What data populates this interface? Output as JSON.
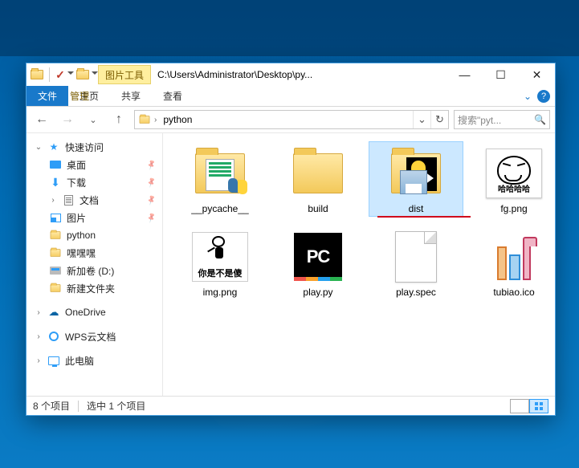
{
  "window": {
    "title_path": "C:\\Users\\Administrator\\Desktop\\py...",
    "tool_tab": "图片工具"
  },
  "ribbon": {
    "file": "文件",
    "home": "主页",
    "share": "共享",
    "view": "查看",
    "manage": "管理"
  },
  "address": {
    "segments": [
      "python"
    ],
    "search_placeholder": "搜索\"pyt..."
  },
  "sidebar": {
    "quick_access": "快速访问",
    "desktop": "桌面",
    "downloads": "下载",
    "documents": "文档",
    "pictures": "图片",
    "python": "python",
    "heiheihei": "嘿嘿嘿",
    "new_volume": "新加卷 (D:)",
    "new_folder": "新建文件夹",
    "onedrive": "OneDrive",
    "wps_cloud": "WPS云文档",
    "this_pc": "此电脑"
  },
  "files": [
    {
      "name": "__pycache__",
      "type": "folder-code",
      "selected": false
    },
    {
      "name": "build",
      "type": "folder",
      "selected": false
    },
    {
      "name": "dist",
      "type": "folder-dist",
      "selected": true,
      "underline": true
    },
    {
      "name": "fg.png",
      "type": "image-fg",
      "caption": "哈哈哈哈",
      "selected": false
    },
    {
      "name": "img.png",
      "type": "image-img",
      "caption": "你是不是傻",
      "selected": false
    },
    {
      "name": "play.py",
      "type": "pycharm",
      "selected": false
    },
    {
      "name": "play.spec",
      "type": "blank",
      "selected": false
    },
    {
      "name": "tubiao.ico",
      "type": "tubiao",
      "selected": false
    }
  ],
  "status": {
    "count_label": "8 个项目",
    "selection_label": "选中 1 个项目"
  }
}
